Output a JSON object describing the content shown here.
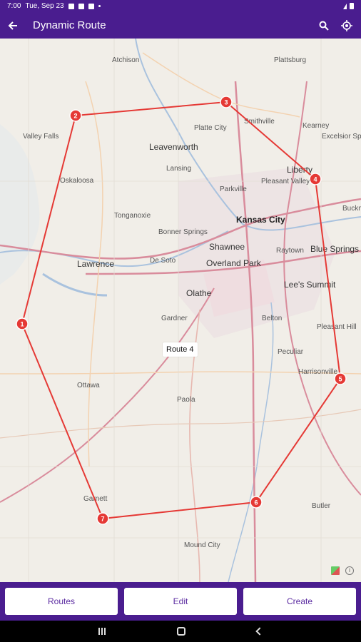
{
  "status": {
    "time": "7:00",
    "date": "Tue, Sep 23"
  },
  "appbar": {
    "title": "Dynamic Route"
  },
  "map": {
    "route_label": "Route 4",
    "waypoints": [
      "1",
      "2",
      "3",
      "4",
      "5",
      "6",
      "7"
    ],
    "places": {
      "atchison": "Atchison",
      "plattsburg": "Plattsburg",
      "valley_falls": "Valley Falls",
      "platte_city": "Platte City",
      "smithville": "Smithville",
      "kearney": "Kearney",
      "excelsior_springs": "Excelsior Springs",
      "leavenworth": "Leavenworth",
      "lansing": "Lansing",
      "liberty": "Liberty",
      "oskaloosa": "Oskaloosa",
      "parkville": "Parkville",
      "pleasant_valley": "Pleasant Valley",
      "tonganoxie": "Tonganoxie",
      "buckner": "Buckn",
      "kansas_city": "Kansas City",
      "bonner_springs": "Bonner Springs",
      "shawnee": "Shawnee",
      "raytown": "Raytown",
      "blue_springs": "Blue Springs",
      "lawrence": "Lawrence",
      "de_soto": "De Soto",
      "overland_park": "Overland Park",
      "lees_summit": "Lee's Summit",
      "olathe": "Olathe",
      "gardner": "Gardner",
      "belton": "Belton",
      "pleasant_hill": "Pleasant Hill",
      "peculiar": "Peculiar",
      "harrisonville": "Harrisonville",
      "ottawa": "Ottawa",
      "paola": "Paola",
      "garnett": "Garnett",
      "butler": "Butler",
      "mound_city": "Mound City"
    }
  },
  "actions": {
    "routes": "Routes",
    "edit": "Edit",
    "create": "Create"
  },
  "colors": {
    "accent": "#4a1d8f",
    "route": "#e53935",
    "button_text": "#5a2aa0"
  }
}
